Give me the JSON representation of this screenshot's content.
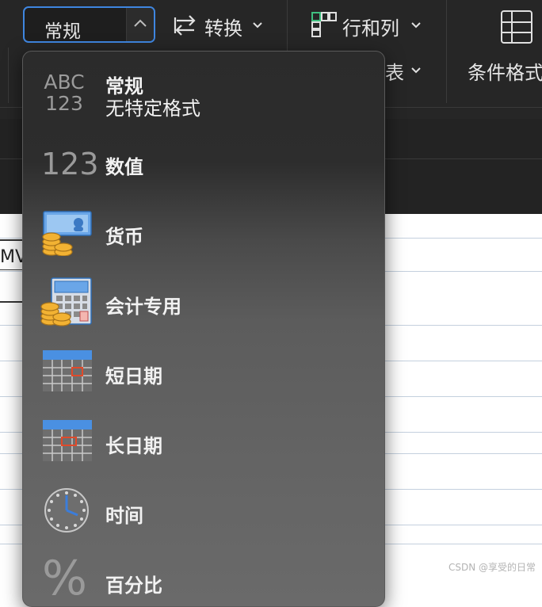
{
  "ribbon": {
    "format_select": {
      "value": "常规"
    },
    "convert_label": "转换",
    "rows_cols_label": "行和列",
    "table_label_partial": "表",
    "conditional_label_partial": "条件格式"
  },
  "sheet": {
    "cell_text_partial": "MV"
  },
  "dropdown": {
    "items": [
      {
        "label": "常规",
        "sub": "无特定格式",
        "icon": "abc-123-icon",
        "abc": "ABC",
        "nums": "123"
      },
      {
        "label": "数值",
        "icon": "number-123-icon",
        "nums": "123"
      },
      {
        "label": "货币",
        "icon": "currency-coins-icon"
      },
      {
        "label": "会计专用",
        "icon": "accounting-calculator-icon"
      },
      {
        "label": "短日期",
        "icon": "short-date-calendar-icon"
      },
      {
        "label": "长日期",
        "icon": "long-date-calendar-icon"
      },
      {
        "label": "时间",
        "icon": "clock-icon"
      },
      {
        "label": "百分比",
        "icon": "percent-icon",
        "glyph": "%"
      }
    ]
  },
  "watermark": "CSDN @享受的日常",
  "colors": {
    "accent": "#3f86e0",
    "ribbon_bg": "#262626",
    "menu_text": "#f2f2f2",
    "icon_blue": "#4a90e2",
    "coin_gold": "#f2b233",
    "date_marker": "#e04a2a",
    "gridline": "#c4d0de"
  }
}
